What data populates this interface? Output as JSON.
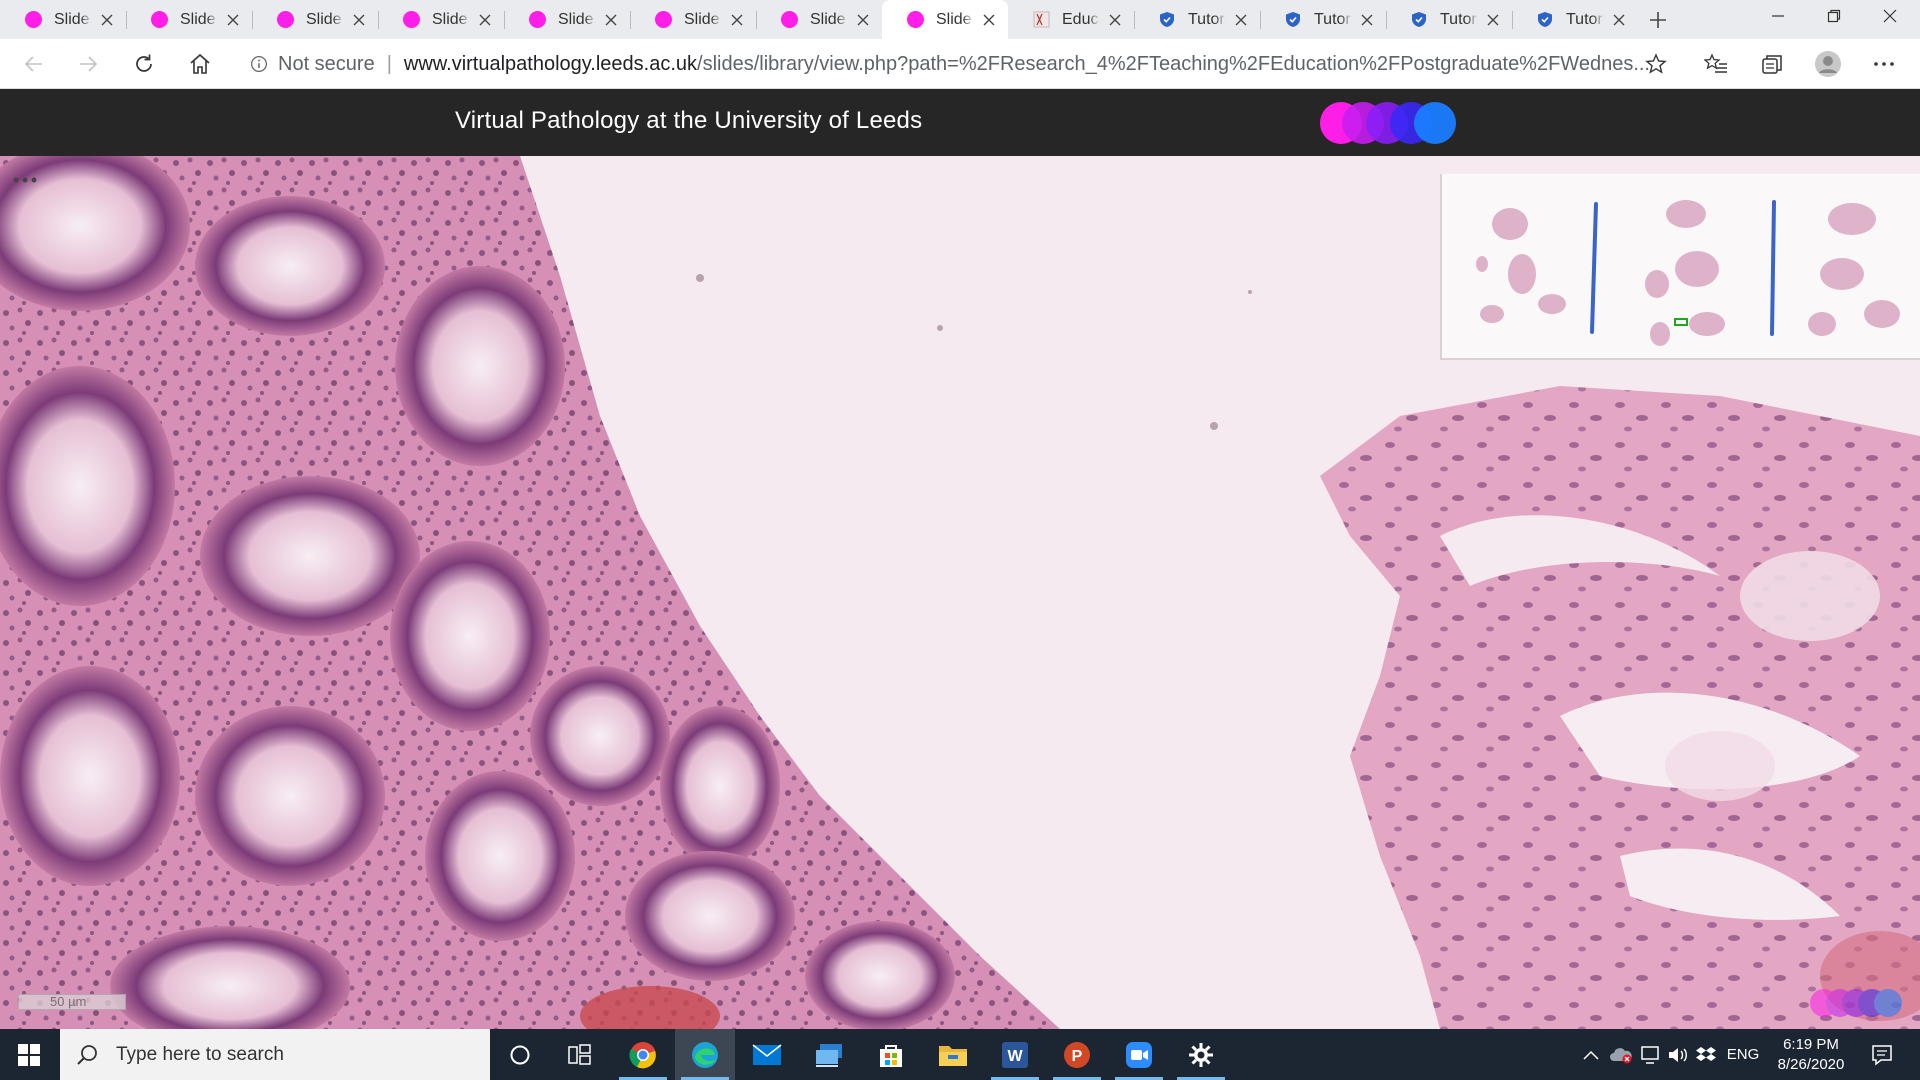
{
  "browser": {
    "tabs": [
      {
        "title": "Slide Viewer",
        "favicon": "pink-circle-icon",
        "active": false
      },
      {
        "title": "Slide Viewer",
        "favicon": "pink-circle-icon",
        "active": false
      },
      {
        "title": "Slide Viewer",
        "favicon": "pink-circle-icon",
        "active": false
      },
      {
        "title": "Slide Viewer",
        "favicon": "pink-circle-icon",
        "active": false
      },
      {
        "title": "Slide Viewer",
        "favicon": "pink-circle-icon",
        "active": false
      },
      {
        "title": "Slide Viewer",
        "favicon": "pink-circle-icon",
        "active": false
      },
      {
        "title": "Slide Viewer",
        "favicon": "pink-circle-icon",
        "active": false
      },
      {
        "title": "Slide Viewer",
        "favicon": "pink-circle-icon",
        "active": true
      },
      {
        "title": "Education",
        "favicon": "book-icon",
        "active": false
      },
      {
        "title": "Tutorial",
        "favicon": "shield-icon",
        "active": false
      },
      {
        "title": "Tutorial",
        "favicon": "shield-icon",
        "active": false
      },
      {
        "title": "Tutorial",
        "favicon": "shield-icon",
        "active": false
      },
      {
        "title": "Tutorial",
        "favicon": "shield-icon",
        "active": false
      }
    ],
    "security_label": "Not secure",
    "url_domain": "www.virtualpathology.leeds.ac.uk",
    "url_path": "/slides/library/view.php?path=%2FResearch_4%2FTeaching%2FEducation%2FPostgraduate%2FWednes..."
  },
  "site": {
    "title": "Virtual Pathology at the University of Leeds",
    "logo_colors": [
      "#ff1ee8",
      "#c81ef0",
      "#8a1ef5",
      "#3a28f5",
      "#1a7cff"
    ]
  },
  "viewer": {
    "scale_label": "50 µm"
  },
  "taskbar": {
    "search_placeholder": "Type here to search",
    "apps": [
      "cortana-icon",
      "task-view-icon",
      "chrome-icon",
      "edge-icon",
      "mail-icon",
      "network-app-icon",
      "store-icon",
      "file-explorer-icon",
      "word-icon",
      "powerpoint-icon",
      "zoom-icon",
      "settings-icon"
    ],
    "language": "ENG",
    "time": "6:19 PM",
    "date": "8/26/2020"
  }
}
